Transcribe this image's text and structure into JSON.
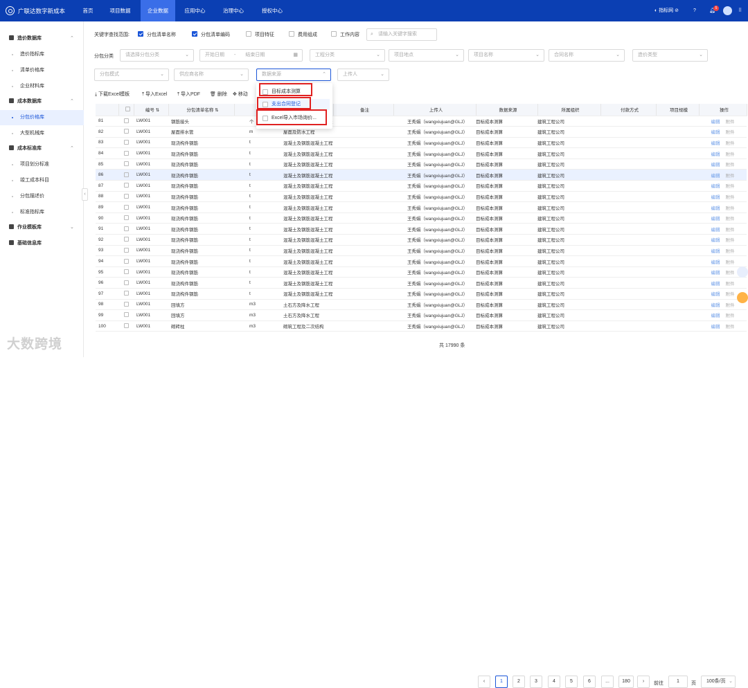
{
  "app": {
    "title": "广联达数字新成本"
  },
  "nav": [
    "首页",
    "项目数据",
    "企业数据",
    "应用中心",
    "治理中心",
    "授权中心"
  ],
  "topright": {
    "brand": "指标网",
    "notif_count": "5"
  },
  "sidebar": [
    {
      "label": "造价数据库",
      "kind": "top",
      "chev": "⌃"
    },
    {
      "label": "造价指标库",
      "kind": "sub"
    },
    {
      "label": "清单价格库",
      "kind": "sub"
    },
    {
      "label": "企业材料库",
      "kind": "sub"
    },
    {
      "label": "成本数据库",
      "kind": "top",
      "chev": "⌃"
    },
    {
      "label": "分包价格库",
      "kind": "sub",
      "selected": true
    },
    {
      "label": "大型机械库",
      "kind": "sub"
    },
    {
      "label": "成本标准库",
      "kind": "top",
      "chev": "⌃"
    },
    {
      "label": "项目划分标准",
      "kind": "sub"
    },
    {
      "label": "竣工成本科目",
      "kind": "sub"
    },
    {
      "label": "分包描述价",
      "kind": "sub"
    },
    {
      "label": "标准指标库",
      "kind": "sub"
    },
    {
      "label": "作业模板库",
      "kind": "top",
      "chev": "⌄"
    },
    {
      "label": "基础信息库",
      "kind": "top",
      "chev": ""
    }
  ],
  "keyword": {
    "label": "关键字查找范围:",
    "options": [
      {
        "label": "分包清单名称",
        "checked": true
      },
      {
        "label": "分包清单编码",
        "checked": true
      },
      {
        "label": "项目特征",
        "checked": false
      },
      {
        "label": "费用组成",
        "checked": false
      },
      {
        "label": "工作内容",
        "checked": false
      }
    ],
    "search_placeholder": "请输入关键字搜索"
  },
  "filters": {
    "category_label": "分包分类",
    "category_placeholder": "请选择分包分类",
    "start_date": "开始日期",
    "end_date": "结束日期",
    "row1": [
      "工程分类",
      "项目地点",
      "项目名称",
      "合同名称",
      "造价类型"
    ],
    "row2": [
      "分包模式",
      "供应商名称",
      "数据来源",
      "上传人"
    ]
  },
  "toolbar": [
    "下载Excel模板",
    "导入Excel",
    "导入PDF",
    "删除",
    "移动"
  ],
  "dropdown": [
    {
      "label": "目标成本测算",
      "selected": false
    },
    {
      "label": "支出合同登记",
      "selected": true
    },
    {
      "label": "Excel导入市场询价...",
      "selected": false
    }
  ],
  "left_headers": [
    "编号 ⇅",
    "分包清单名称 ⇅",
    "计"
  ],
  "right_headers": [
    "",
    "备注",
    "上传人",
    "数据来源",
    "所属组织",
    "付款方式",
    "项目规模",
    "操作"
  ],
  "rows": [
    {
      "n": "81",
      "code": "LW001",
      "name": "钢筋接头",
      "unit": "个",
      "desc": "混凝土及钢筋混凝土工程",
      "up": "王秀娟（wangxiujuan@GLJ）",
      "src": "目标成本测算",
      "org": "建筑工程公司"
    },
    {
      "n": "82",
      "code": "LW001",
      "name": "屋面排水管",
      "unit": "m",
      "desc": "屋面及防水工程",
      "up": "王秀娟（wangxiujuan@GLJ）",
      "src": "目标成本测算",
      "org": "建筑工程公司"
    },
    {
      "n": "83",
      "code": "LW001",
      "name": "现浇构件钢筋",
      "unit": "t",
      "desc": "混凝土及钢筋混凝土工程",
      "up": "王秀娟（wangxiujuan@GLJ）",
      "src": "目标成本测算",
      "org": "建筑工程公司"
    },
    {
      "n": "84",
      "code": "LW001",
      "name": "现浇构件钢筋",
      "unit": "t",
      "desc": "混凝土及钢筋混凝土工程",
      "up": "王秀娟（wangxiujuan@GLJ）",
      "src": "目标成本测算",
      "org": "建筑工程公司"
    },
    {
      "n": "85",
      "code": "LW001",
      "name": "现浇构件钢筋",
      "unit": "t",
      "desc": "混凝土及钢筋混凝土工程",
      "up": "王秀娟（wangxiujuan@GLJ）",
      "src": "目标成本测算",
      "org": "建筑工程公司"
    },
    {
      "n": "86",
      "code": "LW001",
      "name": "现浇构件钢筋",
      "unit": "t",
      "desc": "混凝土及钢筋混凝土工程",
      "up": "王秀娟（wangxiujuan@GLJ）",
      "src": "目标成本测算",
      "org": "建筑工程公司"
    },
    {
      "n": "87",
      "code": "LW001",
      "name": "现浇构件钢筋",
      "unit": "t",
      "desc": "混凝土及钢筋混凝土工程",
      "up": "王秀娟（wangxiujuan@GLJ）",
      "src": "目标成本测算",
      "org": "建筑工程公司"
    },
    {
      "n": "88",
      "code": "LW001",
      "name": "现浇构件钢筋",
      "unit": "t",
      "desc": "混凝土及钢筋混凝土工程",
      "up": "王秀娟（wangxiujuan@GLJ）",
      "src": "目标成本测算",
      "org": "建筑工程公司"
    },
    {
      "n": "89",
      "code": "LW001",
      "name": "现浇构件钢筋",
      "unit": "t",
      "desc": "混凝土及钢筋混凝土工程",
      "up": "王秀娟（wangxiujuan@GLJ）",
      "src": "目标成本测算",
      "org": "建筑工程公司"
    },
    {
      "n": "90",
      "code": "LW001",
      "name": "现浇构件钢筋",
      "unit": "t",
      "desc": "混凝土及钢筋混凝土工程",
      "up": "王秀娟（wangxiujuan@GLJ）",
      "src": "目标成本测算",
      "org": "建筑工程公司"
    },
    {
      "n": "91",
      "code": "LW001",
      "name": "现浇构件钢筋",
      "unit": "t",
      "desc": "混凝土及钢筋混凝土工程",
      "up": "王秀娟（wangxiujuan@GLJ）",
      "src": "目标成本测算",
      "org": "建筑工程公司"
    },
    {
      "n": "92",
      "code": "LW001",
      "name": "现浇构件钢筋",
      "unit": "t",
      "desc": "混凝土及钢筋混凝土工程",
      "up": "王秀娟（wangxiujuan@GLJ）",
      "src": "目标成本测算",
      "org": "建筑工程公司"
    },
    {
      "n": "93",
      "code": "LW001",
      "name": "现浇构件钢筋",
      "unit": "t",
      "desc": "混凝土及钢筋混凝土工程",
      "up": "王秀娟（wangxiujuan@GLJ）",
      "src": "目标成本测算",
      "org": "建筑工程公司"
    },
    {
      "n": "94",
      "code": "LW001",
      "name": "现浇构件钢筋",
      "unit": "t",
      "desc": "混凝土及钢筋混凝土工程",
      "up": "王秀娟（wangxiujuan@GLJ）",
      "src": "目标成本测算",
      "org": "建筑工程公司"
    },
    {
      "n": "95",
      "code": "LW001",
      "name": "现浇构件钢筋",
      "unit": "t",
      "desc": "混凝土及钢筋混凝土工程",
      "up": "王秀娟（wangxiujuan@GLJ）",
      "src": "目标成本测算",
      "org": "建筑工程公司"
    },
    {
      "n": "96",
      "code": "LW001",
      "name": "现浇构件钢筋",
      "unit": "t",
      "desc": "混凝土及钢筋混凝土工程",
      "up": "王秀娟（wangxiujuan@GLJ）",
      "src": "目标成本测算",
      "org": "建筑工程公司"
    },
    {
      "n": "97",
      "code": "LW001",
      "name": "现浇构件钢筋",
      "unit": "t",
      "desc": "混凝土及钢筋混凝土工程",
      "up": "王秀娟（wangxiujuan@GLJ）",
      "src": "目标成本测算",
      "org": "建筑工程公司"
    },
    {
      "n": "98",
      "code": "LW001",
      "name": "回填方",
      "unit": "m3",
      "desc": "土石方及降水工程",
      "up": "王秀娟（wangxiujuan@GLJ）",
      "src": "目标成本测算",
      "org": "建筑工程公司"
    },
    {
      "n": "99",
      "code": "LW001",
      "name": "回填方",
      "unit": "m3",
      "desc": "土石方及降水工程",
      "up": "王秀娟（wangxiujuan@GLJ）",
      "src": "目标成本测算",
      "org": "建筑工程公司"
    },
    {
      "n": "100",
      "code": "LW001",
      "name": "砌砖柱",
      "unit": "m3",
      "desc": "砌筑工程及二次结构",
      "up": "王秀娟（wangxiujuan@GLJ）",
      "src": "目标成本测算",
      "org": "建筑工程公司"
    }
  ],
  "highlighted_row": "86",
  "row_actions": {
    "edit": "编辑",
    "attach": "附件"
  },
  "pagination": {
    "total": "共 17990 条",
    "prev": "‹",
    "pages": [
      "1",
      "2",
      "3",
      "4",
      "5",
      "6",
      "...",
      "180"
    ],
    "current": "1",
    "next": "›",
    "goto_label": "前往",
    "goto_value": "1",
    "page_unit": "页",
    "per_page": "100条/页"
  },
  "watermark": "大数跨境"
}
